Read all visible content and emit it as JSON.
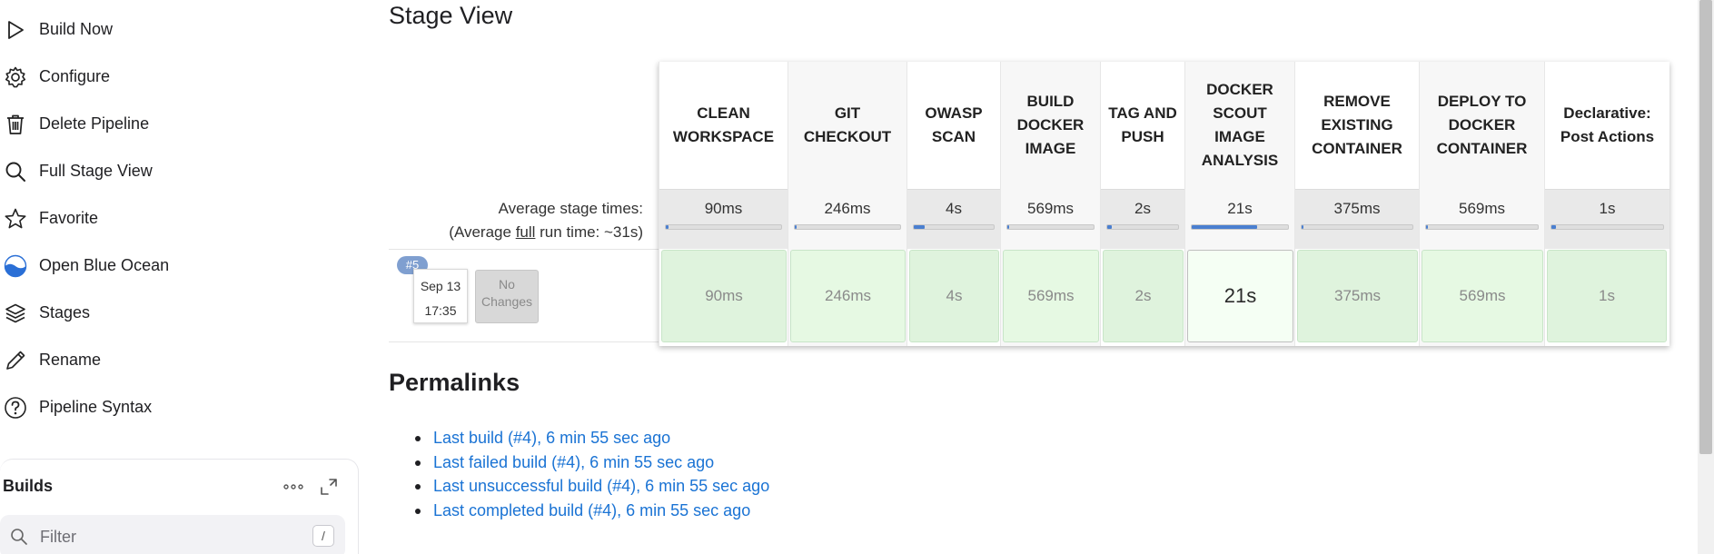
{
  "sidebar": {
    "items": [
      {
        "label": "Build Now",
        "icon": "play-icon"
      },
      {
        "label": "Configure",
        "icon": "gear-icon"
      },
      {
        "label": "Delete Pipeline",
        "icon": "trash-icon"
      },
      {
        "label": "Full Stage View",
        "icon": "search-icon"
      },
      {
        "label": "Favorite",
        "icon": "star-icon"
      },
      {
        "label": "Open Blue Ocean",
        "icon": "blue-ocean-icon"
      },
      {
        "label": "Stages",
        "icon": "layers-icon"
      },
      {
        "label": "Rename",
        "icon": "pencil-icon"
      },
      {
        "label": "Pipeline Syntax",
        "icon": "help-icon"
      }
    ],
    "builds": {
      "title": "Builds",
      "filter_placeholder": "Filter",
      "filter_shortcut": "/"
    }
  },
  "stage_view": {
    "title": "Stage View",
    "avg_stage_label": "Average stage times:",
    "avg_run_prefix": "(Average ",
    "avg_run_link": "full",
    "avg_run_suffix": " run time: ~31s)",
    "stages": [
      {
        "name": "CLEAN WORKSPACE",
        "avg": "90ms",
        "avg_fraction": 0.004,
        "run": "90ms"
      },
      {
        "name": "GIT CHECKOUT",
        "avg": "246ms",
        "avg_fraction": 0.01,
        "run": "246ms"
      },
      {
        "name": "OWASP SCAN",
        "avg": "4s",
        "avg_fraction": 0.14,
        "run": "4s"
      },
      {
        "name": "BUILD DOCKER IMAGE",
        "avg": "569ms",
        "avg_fraction": 0.02,
        "run": "569ms"
      },
      {
        "name": "TAG AND PUSH",
        "avg": "2s",
        "avg_fraction": 0.07,
        "run": "2s"
      },
      {
        "name": "DOCKER SCOUT IMAGE ANALYSIS",
        "avg": "21s",
        "avg_fraction": 0.68,
        "run": "21s"
      },
      {
        "name": "REMOVE EXISTING CONTAINER",
        "avg": "375ms",
        "avg_fraction": 0.012,
        "run": "375ms"
      },
      {
        "name": "DEPLOY TO DOCKER CONTAINER",
        "avg": "569ms",
        "avg_fraction": 0.02,
        "run": "569ms"
      },
      {
        "name": "Declarative: Post Actions",
        "avg": "1s",
        "avg_fraction": 0.04,
        "run": "1s"
      }
    ],
    "build": {
      "badge": "#5",
      "date": "Sep 13",
      "time": "17:35",
      "changes": "No Changes"
    }
  },
  "permalinks": {
    "title": "Permalinks",
    "links": [
      "Last build (#4), 6 min 55 sec ago",
      "Last failed build (#4), 6 min 55 sec ago",
      "Last unsuccessful build (#4), 6 min 55 sec ago",
      "Last completed build (#4), 6 min 55 sec ago"
    ]
  },
  "colors": {
    "link": "#1a73d4",
    "success_cell": "#dff3dd",
    "bar_fill": "#4a7fd0",
    "badge": "#7f9fd0"
  }
}
